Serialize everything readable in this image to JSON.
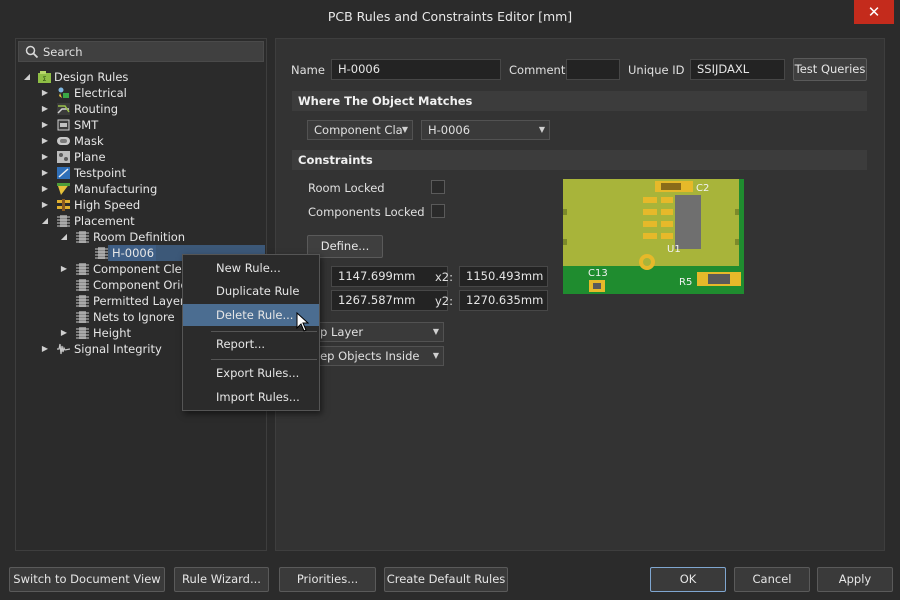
{
  "window": {
    "title": "PCB Rules and Constraints Editor [mm]"
  },
  "search": {
    "placeholder": "Search"
  },
  "tree": {
    "root": "Design Rules",
    "items": [
      {
        "label": "Electrical",
        "icon": "electrical-icon"
      },
      {
        "label": "Routing",
        "icon": "routing-icon"
      },
      {
        "label": "SMT",
        "icon": "smt-icon"
      },
      {
        "label": "Mask",
        "icon": "mask-icon"
      },
      {
        "label": "Plane",
        "icon": "plane-icon"
      },
      {
        "label": "Testpoint",
        "icon": "testpoint-icon"
      },
      {
        "label": "Manufacturing",
        "icon": "manufacturing-icon"
      },
      {
        "label": "High Speed",
        "icon": "high-speed-icon"
      },
      {
        "label": "Placement",
        "icon": "placement-icon"
      }
    ],
    "placement_children": [
      {
        "label": "Room Definition"
      },
      {
        "label": "H-0006"
      },
      {
        "label": "Component Clear"
      },
      {
        "label": "Component Orien"
      },
      {
        "label": "Permitted Layers"
      },
      {
        "label": "Nets to Ignore"
      },
      {
        "label": "Height"
      }
    ],
    "signal_integrity": "Signal Integrity"
  },
  "rule": {
    "name_label": "Name",
    "name_value": "H-0006",
    "comment_label": "Comment",
    "comment_value": "",
    "uid_label": "Unique ID",
    "uid_value": "SSIJDAXL",
    "test_queries": "Test Queries"
  },
  "where": {
    "header": "Where The Object Matches",
    "type_value": "Component Cla",
    "object_value": "H-0006"
  },
  "constraints": {
    "header": "Constraints",
    "room_locked": "Room Locked",
    "room_locked_checked": false,
    "components_locked": "Components Locked",
    "components_locked_checked": false,
    "define": "Define...",
    "x1": "1147.699mm",
    "x2_label": "x2:",
    "x2": "1150.493mm",
    "y1": "1267.587mm",
    "y2_label": "y2:",
    "y2": "1270.635mm",
    "layer": "op Layer",
    "keep": "eep Objects Inside"
  },
  "preview": {
    "labels": {
      "c2": "C2",
      "u1": "U1",
      "c13": "C13",
      "r5": "R5"
    },
    "colors": {
      "board": "#a8b43a",
      "pad": "#e6b92a",
      "chip": "#6f6f6f",
      "room": "#1f8c2f"
    }
  },
  "context_menu": {
    "items": [
      "New Rule...",
      "Duplicate Rule",
      "Delete Rule...",
      "Report...",
      "Export Rules...",
      "Import Rules..."
    ],
    "active": "Delete Rule..."
  },
  "footer": {
    "switch": "Switch to Document View",
    "wizard": "Rule Wizard...",
    "priorities": "Priorities...",
    "create_default": "Create Default Rules",
    "ok": "OK",
    "cancel": "Cancel",
    "apply": "Apply"
  }
}
